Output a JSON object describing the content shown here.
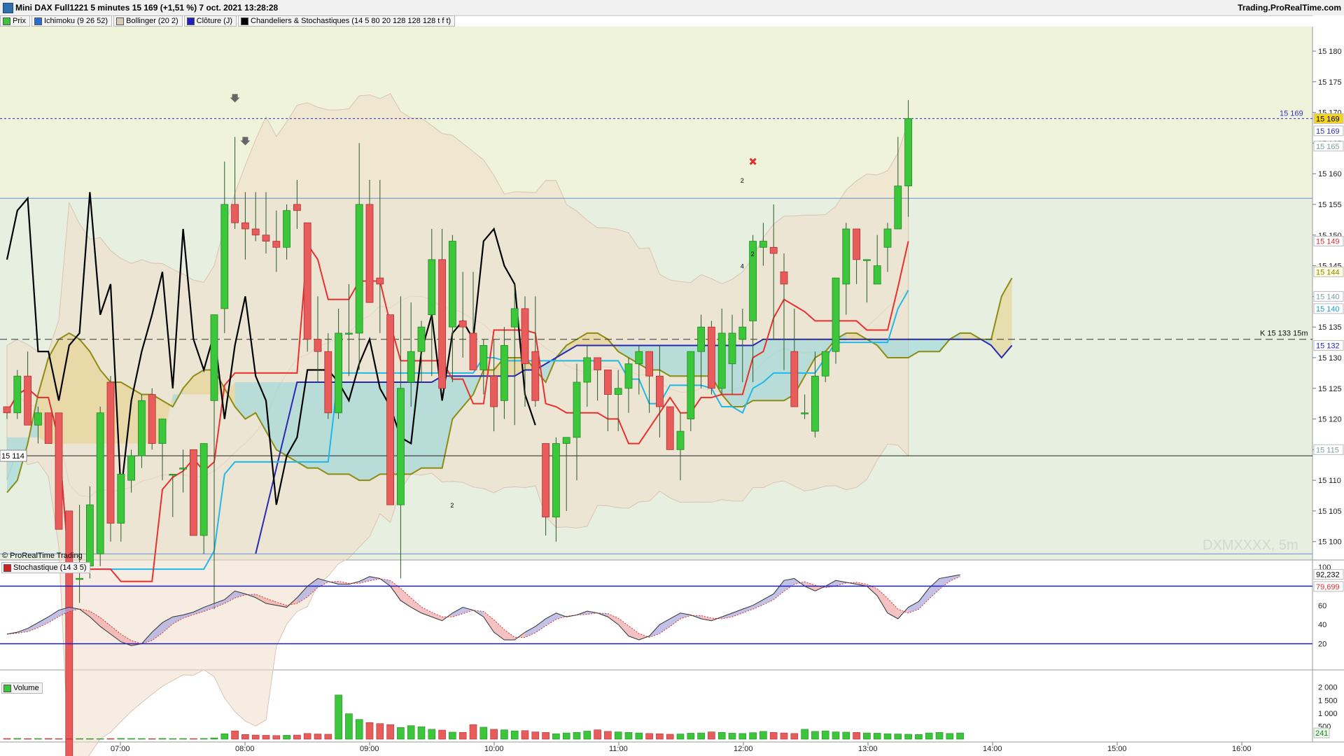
{
  "window": {
    "title": "Mini DAX Full1221 5 minutes 15 169 (+1,51 %) 7 oct. 2021 13:28:28",
    "brand": "Trading.ProRealTime.com"
  },
  "legend": [
    {
      "label": "Prix",
      "color": "#3cc63c"
    },
    {
      "label": "Ichimoku (9 26 52)",
      "color": "#2b6ccf"
    },
    {
      "label": "Bollinger (20 2)",
      "color": "#d9c8b4"
    },
    {
      "label": "Clôture (J)",
      "color": "#2020c0"
    },
    {
      "label": "Chandeliers & Stochastiques (14 5 80 20 128 128 128 t f t)",
      "color": "#000000"
    }
  ],
  "price_panel": {
    "axis_ticks": [
      "15 180",
      "15 175",
      "15 170",
      "15 165",
      "15 160",
      "15 155",
      "15 150",
      "15 145",
      "15 140",
      "15 135",
      "15 130",
      "15 125",
      "15 120",
      "15 115",
      "15 110",
      "15 105",
      "15 100"
    ],
    "price_badges": [
      {
        "text": "15 169",
        "bg": "#f5d51a",
        "fg": "#000000"
      },
      {
        "text": "15 169",
        "bg": "#ffffff",
        "fg": "#3030c0"
      },
      {
        "text": "15 165",
        "bg": "#ffffff",
        "fg": "#7aa0a0"
      },
      {
        "text": "15 149",
        "bg": "#ffffff",
        "fg": "#e03030"
      },
      {
        "text": "15 144",
        "bg": "#fffbe0",
        "fg": "#8c8c00"
      },
      {
        "text": "15 140",
        "bg": "#ffffff",
        "fg": "#7aa0a0"
      },
      {
        "text": "15 140",
        "bg": "#ffffff",
        "fg": "#1a9ee0"
      },
      {
        "text": "15 132",
        "bg": "#ffffff",
        "fg": "#2020c0"
      },
      {
        "text": "15 115",
        "bg": "#ffffff",
        "fg": "#7aa0a0"
      }
    ],
    "current_line_label": "15 169",
    "kijun_label": "K 15 133 15m",
    "left_level_label": "15 114",
    "watermark": "DXMXXXX, 5m",
    "copyright": "© ProRealTime Trading"
  },
  "candles": [
    [
      15122,
      15122,
      15120,
      15121
    ],
    [
      15121,
      15128,
      15120,
      15127
    ],
    [
      15127,
      15131,
      15119,
      15119
    ],
    [
      15119,
      15122,
      15116,
      15121
    ],
    [
      15121,
      15121,
      15116,
      15116
    ],
    [
      15121,
      15121,
      15102,
      15102
    ],
    [
      15105,
      15105,
      15060,
      15060
    ],
    [
      15094,
      15106,
      15090,
      15094
    ],
    [
      15096,
      15109,
      15094,
      15106
    ],
    [
      15098,
      15122,
      15096,
      15121
    ],
    [
      15126,
      15127,
      15100,
      15103
    ],
    [
      15103,
      15111,
      15100,
      15111
    ],
    [
      15110,
      15115,
      15108,
      15114
    ],
    [
      15114,
      15124,
      15112,
      15123
    ],
    [
      15124,
      15125,
      15115,
      15116
    ],
    [
      15116,
      15120,
      15110,
      15120
    ],
    [
      15111,
      15111,
      15104,
      15111
    ],
    [
      15112,
      15115,
      15108,
      15112
    ],
    [
      15115,
      15115,
      15101,
      15101
    ],
    [
      15101,
      15116,
      15098,
      15116
    ],
    [
      15123,
      15137,
      15089,
      15137
    ],
    [
      15138,
      15162,
      15134,
      15155
    ],
    [
      15155,
      15166,
      15151,
      15152
    ],
    [
      15152,
      15157,
      15146,
      15151
    ],
    [
      15151,
      15157,
      15149,
      15150
    ],
    [
      15150,
      15157,
      15147,
      15149
    ],
    [
      15149,
      15154,
      15144,
      15148
    ],
    [
      15148,
      15155,
      15146,
      15154
    ],
    [
      15155,
      15159,
      15151,
      15154
    ],
    [
      15152,
      15152,
      15131,
      15133
    ],
    [
      15133,
      15140,
      15126,
      15131
    ],
    [
      15131,
      15134,
      15120,
      15121
    ],
    [
      15121,
      15138,
      15120,
      15134
    ],
    [
      15134,
      15142,
      15127,
      15134
    ],
    [
      15134,
      15165,
      15128,
      15155
    ],
    [
      15155,
      15159,
      15140,
      15139
    ],
    [
      15143,
      15159,
      15134,
      15142
    ],
    [
      15137,
      15137,
      15106,
      15106
    ],
    [
      15106,
      15140,
      15094,
      15125
    ],
    [
      15126,
      15139,
      15122,
      15131
    ],
    [
      15131,
      15136,
      15126,
      15135
    ],
    [
      15137,
      15151,
      15127,
      15146
    ],
    [
      15146,
      15151,
      15130,
      15125
    ],
    [
      15135,
      15150,
      15126,
      15149
    ],
    [
      15136,
      15144,
      15130,
      15135
    ],
    [
      15134,
      15144,
      15130,
      15128
    ],
    [
      15128,
      15133,
      15124,
      15132
    ],
    [
      15127,
      15133,
      15118,
      15122
    ],
    [
      15123,
      15135,
      15120,
      15132
    ],
    [
      15135,
      15142,
      15119,
      15138
    ],
    [
      15138,
      15140,
      15122,
      15129
    ],
    [
      15131,
      15140,
      15122,
      15123
    ],
    [
      15116,
      15116,
      15101,
      15104
    ],
    [
      15104,
      15117,
      15100,
      15116
    ],
    [
      15116,
      15117,
      15105,
      15117
    ],
    [
      15117,
      15129,
      15110,
      15126
    ],
    [
      15126,
      15132,
      15122,
      15130
    ],
    [
      15130,
      15130,
      15123,
      15128
    ],
    [
      15128,
      15128,
      15118,
      15124
    ],
    [
      15124,
      15128,
      15118,
      15125
    ],
    [
      15125,
      15130,
      15121,
      15129
    ],
    [
      15129,
      15132,
      15124,
      15131
    ],
    [
      15131,
      15131,
      15121,
      15127
    ],
    [
      15127,
      15132,
      15117,
      15122
    ],
    [
      15122,
      15122,
      15115,
      15115
    ],
    [
      15115,
      15121,
      15110,
      15118
    ],
    [
      15120,
      15131,
      15118,
      15131
    ],
    [
      15131,
      15137,
      15125,
      15135
    ],
    [
      15135,
      15136,
      15124,
      15125
    ],
    [
      15125,
      15138,
      15124,
      15134
    ],
    [
      15129,
      15137,
      15124,
      15134
    ],
    [
      15133,
      15138,
      15126,
      15135
    ],
    [
      15136,
      15150,
      15126,
      15149
    ],
    [
      15148,
      15152,
      15145,
      15149
    ],
    [
      15148,
      15155,
      15133,
      15147
    ],
    [
      15144,
      15147,
      15128,
      15142
    ],
    [
      15131,
      15138,
      15122,
      15122
    ],
    [
      15121,
      15124,
      15120,
      15121
    ],
    [
      15118,
      15131,
      15117,
      15127
    ],
    [
      15127,
      15131,
      15126,
      15131
    ],
    [
      15131,
      15136,
      15129,
      15143
    ],
    [
      15142,
      15152,
      15137,
      15151
    ],
    [
      15151,
      15151,
      15142,
      15146
    ],
    [
      15146,
      15146,
      15139,
      15146
    ],
    [
      15142,
      15150,
      15142,
      15145
    ],
    [
      15148,
      15152,
      15144,
      15151
    ],
    [
      15151,
      15166,
      15151,
      15158
    ],
    [
      15158,
      15172,
      15153,
      15169
    ]
  ],
  "stochastic_panel": {
    "tag": "Stochastique (14 3 5)",
    "axis_ticks": [
      "100",
      "80",
      "60",
      "40",
      "20"
    ],
    "badges": [
      {
        "text": "92,232",
        "fg": "#000000"
      },
      {
        "text": "79,699",
        "fg": "#e03030"
      }
    ],
    "k": [
      30,
      32,
      36,
      42,
      48,
      55,
      58,
      56,
      48,
      38,
      30,
      22,
      18,
      20,
      32,
      42,
      48,
      50,
      53,
      58,
      62,
      66,
      75,
      72,
      68,
      62,
      60,
      58,
      68,
      80,
      88,
      85,
      82,
      82,
      85,
      90,
      88,
      80,
      65,
      58,
      52,
      48,
      44,
      52,
      58,
      55,
      48,
      32,
      24,
      24,
      32,
      38,
      46,
      52,
      48,
      50,
      54,
      52,
      48,
      40,
      28,
      24,
      28,
      40,
      46,
      52,
      50,
      46,
      44,
      48,
      52,
      56,
      60,
      66,
      72,
      86,
      88,
      80,
      75,
      80,
      86,
      84,
      82,
      80,
      70,
      52,
      46,
      58,
      64,
      78,
      88,
      90,
      92
    ]
  },
  "volume_panel": {
    "tag": "Volume",
    "axis_ticks": [
      "2 000",
      "1 500",
      "1 000",
      "500"
    ],
    "badge": "241",
    "values": [
      25,
      28,
      22,
      24,
      26,
      21,
      20,
      24,
      22,
      19,
      24,
      30,
      26,
      24,
      20,
      28,
      22,
      25,
      23,
      28,
      50,
      210,
      320,
      180,
      160,
      150,
      140,
      150,
      160,
      220,
      200,
      190,
      1700,
      980,
      760,
      640,
      600,
      560,
      450,
      520,
      480,
      380,
      350,
      270,
      260,
      560,
      460,
      380,
      360,
      320,
      330,
      280,
      260,
      210,
      240,
      260,
      310,
      360,
      300,
      280,
      260,
      240,
      220,
      210,
      190,
      200,
      230,
      240,
      280,
      260,
      230,
      220,
      250,
      300,
      260,
      240,
      220,
      380,
      300,
      320,
      280,
      270,
      260,
      240,
      230,
      210,
      200,
      190,
      180,
      240,
      260,
      220,
      241
    ]
  },
  "time_axis": [
    "07:00",
    "08:00",
    "09:00",
    "10:00",
    "11:00",
    "12:00",
    "13:00",
    "14:00",
    "15:00",
    "16:00"
  ],
  "annotations": {
    "count_labels": [
      "2",
      "2",
      "4",
      "2"
    ]
  },
  "colors": {
    "bull": "#3cc63c",
    "bear": "#e85c5c",
    "tenkan": "#e83030",
    "kijun": "#20b8e8",
    "chikou": "#000000",
    "ssb": "#8c8c14",
    "close_daily": "#2828b4"
  }
}
